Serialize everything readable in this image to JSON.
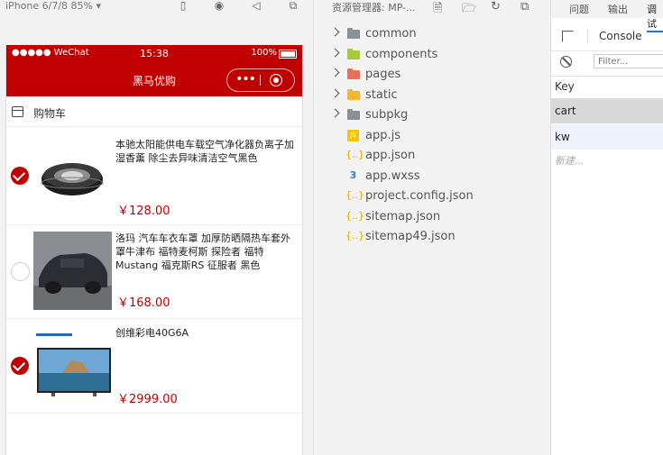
{
  "simulator": {
    "device_label": "iPhone 6/7/8 85% ▾",
    "status": {
      "carrier": "●●●●● WeChat",
      "time": "15:38",
      "battery": "100%",
      "battery_level": 1.0
    },
    "navbar": {
      "title": "黑马优购",
      "capsule_more": "•••"
    },
    "cart": {
      "title": "购物车",
      "items": [
        {
          "name": "本驰太阳能供电车载空气净化器负离子加湿香薰 除尘去异味清洁空气黑色",
          "price": "￥128.00",
          "checked": true
        },
        {
          "name": "洛玛 汽车车衣车罩 加厚防晒隔热车套外罩牛津布 福特麦柯斯 探险者 福特Mustang 福克斯RS 征服者 黑色",
          "price": "￥168.00",
          "checked": false
        },
        {
          "name": "创维彩电40G6A",
          "price": "￥2999.00",
          "checked": true
        }
      ]
    }
  },
  "explorer": {
    "title": "资源管理器: MP-...",
    "tree": [
      {
        "label": "common",
        "kind": "folder",
        "color": "#8a9199"
      },
      {
        "label": "components",
        "kind": "folder",
        "color": "#a8c93a"
      },
      {
        "label": "pages",
        "kind": "folder",
        "color": "#e8715a"
      },
      {
        "label": "static",
        "kind": "folder",
        "color": "#f2b632"
      },
      {
        "label": "subpkg",
        "kind": "folder",
        "color": "#8a9199"
      },
      {
        "label": "app.js",
        "kind": "js"
      },
      {
        "label": "app.json",
        "kind": "json"
      },
      {
        "label": "app.wxss",
        "kind": "css"
      },
      {
        "label": "project.config.json",
        "kind": "json"
      },
      {
        "label": "sitemap.json",
        "kind": "json"
      },
      {
        "label": "sitemap49.json",
        "kind": "json"
      }
    ]
  },
  "debug": {
    "tabs": [
      "问题",
      "输出",
      "调试"
    ],
    "console_label": "Console",
    "filter_placeholder": "Filter...",
    "key_header": "Key",
    "storage_keys": [
      "cart",
      "kw"
    ],
    "new_entry": "新建..."
  }
}
